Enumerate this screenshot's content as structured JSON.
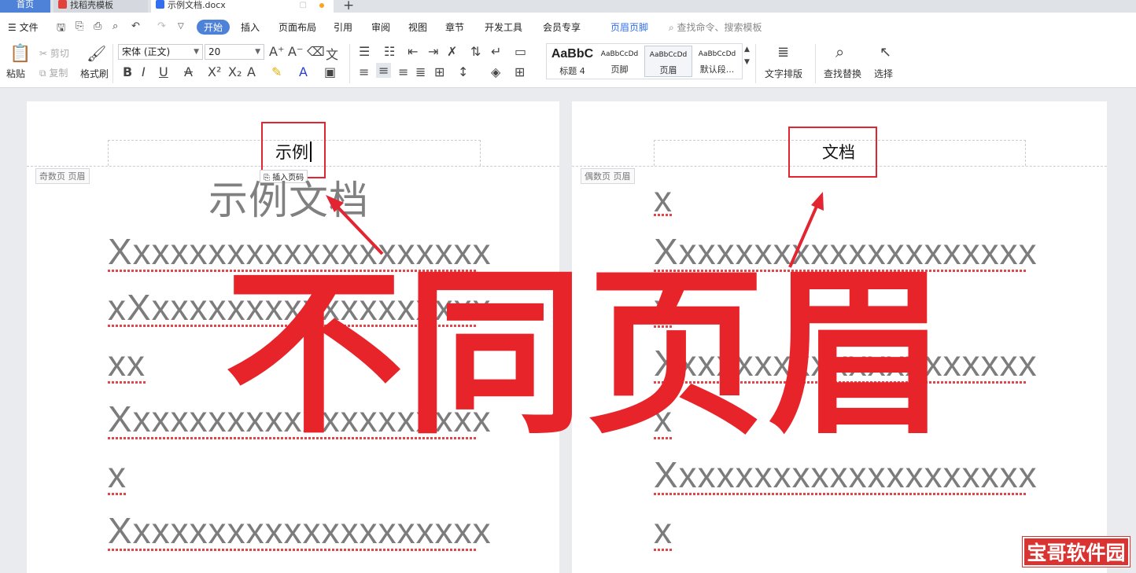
{
  "tabs": {
    "home": "首页",
    "template": "找稻壳模板",
    "document": "示例文档.docx",
    "new": "+"
  },
  "menu": {
    "file": "文件",
    "items": [
      "开始",
      "插入",
      "页面布局",
      "引用",
      "审阅",
      "视图",
      "章节",
      "开发工具",
      "会员专享",
      "页眉页脚"
    ],
    "active": "开始",
    "search": "查找命令、搜索模板"
  },
  "ribbon": {
    "paste": "粘贴",
    "cut": "剪切",
    "copy": "复制",
    "format_painter": "格式刷",
    "font_name": "宋体 (正文)",
    "font_size": "20",
    "styles": [
      {
        "preview": "AaBbC",
        "name": "标题 4"
      },
      {
        "preview": "AaBbCcDd",
        "name": "页脚"
      },
      {
        "preview": "AaBbCcDd",
        "name": "页眉"
      },
      {
        "preview": "AaBbCcDd",
        "name": "默认段..."
      }
    ],
    "text_layout": "文字排版",
    "find_replace": "查找替换",
    "select": "选择"
  },
  "left_page": {
    "header_label": "奇数页 页眉",
    "header_text": "示例",
    "insert_page_number": "插入页码",
    "title": "示例文档",
    "lines": [
      "Xxxxxxxxxxxxxxxxxxxx",
      "xXxxxxxxxxxxxxxxxxxx",
      "xx",
      "Xxxxxxxxxxxxxxxxxxxx",
      "x",
      "Xxxxxxxxxxxxxxxxxxxx"
    ]
  },
  "right_page": {
    "header_label": "偶数页 页眉",
    "header_text": "文档",
    "lines": [
      "x",
      "Xxxxxxxxxxxxxxxxxxxx",
      "x",
      "Xxxxxxxxxxxxxxxxxxxx",
      "x",
      "Xxxxxxxxxxxxxxxxxxxx",
      "x"
    ]
  },
  "overlay": {
    "caption": "不同页眉"
  },
  "watermark": "宝哥软件园",
  "colors": {
    "accent": "#4e82d8",
    "annotation_red": "#e8242b"
  }
}
